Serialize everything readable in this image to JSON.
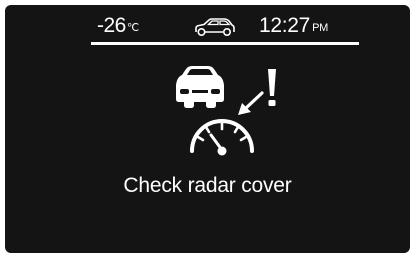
{
  "status": {
    "temperature": "-26",
    "temperature_unit": "℃",
    "time": "12:27",
    "ampm": "PM",
    "vehicle_icon": "car-outline-icon"
  },
  "warning": {
    "icon": "radar-cover-warning-icon",
    "message": "Check radar cover"
  },
  "colors": {
    "background": "#141414",
    "foreground": "#ffffff"
  }
}
